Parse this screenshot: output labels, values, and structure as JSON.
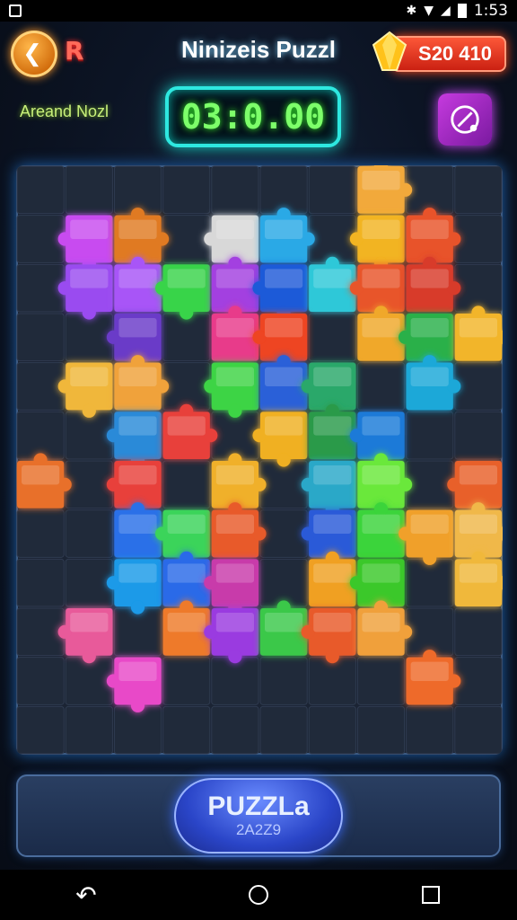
{
  "status_bar": {
    "time": "1:53"
  },
  "header": {
    "back_button_icon": "back-arrow-icon",
    "restart_label": "R",
    "title": "Ninizeis Puzzl",
    "score": "S20 410",
    "score_icon": "gem-icon"
  },
  "subheader": {
    "level_label": "Areand Nozl",
    "timer": "03:0.00",
    "hint_icon": "pencil-icon"
  },
  "board": {
    "columns": 10,
    "rows": 12,
    "pieces": [
      {
        "c": 7,
        "r": 0,
        "color": "#f2a93b"
      },
      {
        "c": 1,
        "r": 1,
        "color": "#c84cf0"
      },
      {
        "c": 2,
        "r": 1,
        "color": "#e07a22"
      },
      {
        "c": 4,
        "r": 1,
        "color": "#d8d8d8"
      },
      {
        "c": 5,
        "r": 1,
        "color": "#2aa9e6"
      },
      {
        "c": 7,
        "r": 1,
        "color": "#f2b420"
      },
      {
        "c": 8,
        "r": 1,
        "color": "#e8532a"
      },
      {
        "c": 1,
        "r": 2,
        "color": "#9a4cf0"
      },
      {
        "c": 2,
        "r": 2,
        "color": "#a855f7"
      },
      {
        "c": 3,
        "r": 2,
        "color": "#38d44a"
      },
      {
        "c": 4,
        "r": 2,
        "color": "#a340e0"
      },
      {
        "c": 5,
        "r": 2,
        "color": "#1f5ad8"
      },
      {
        "c": 6,
        "r": 2,
        "color": "#2ec8d8"
      },
      {
        "c": 7,
        "r": 2,
        "color": "#e8542a"
      },
      {
        "c": 8,
        "r": 2,
        "color": "#d83a2a"
      },
      {
        "c": 2,
        "r": 3,
        "color": "#6a3ac8"
      },
      {
        "c": 4,
        "r": 3,
        "color": "#e83a8a"
      },
      {
        "c": 5,
        "r": 3,
        "color": "#ee4420"
      },
      {
        "c": 7,
        "r": 3,
        "color": "#f0a82a"
      },
      {
        "c": 8,
        "r": 3,
        "color": "#2ab04a"
      },
      {
        "c": 9,
        "r": 3,
        "color": "#f2b52a"
      },
      {
        "c": 1,
        "r": 4,
        "color": "#f0b73a"
      },
      {
        "c": 2,
        "r": 4,
        "color": "#f0a23a"
      },
      {
        "c": 4,
        "r": 4,
        "color": "#3ed444"
      },
      {
        "c": 5,
        "r": 4,
        "color": "#2a60d8"
      },
      {
        "c": 6,
        "r": 4,
        "color": "#2aa86a"
      },
      {
        "c": 8,
        "r": 4,
        "color": "#1aa8d8"
      },
      {
        "c": 2,
        "r": 5,
        "color": "#2a8ad8"
      },
      {
        "c": 3,
        "r": 5,
        "color": "#e8403a"
      },
      {
        "c": 5,
        "r": 5,
        "color": "#f0b020"
      },
      {
        "c": 6,
        "r": 5,
        "color": "#2a9a4a"
      },
      {
        "c": 7,
        "r": 5,
        "color": "#1a7ad8"
      },
      {
        "c": 0,
        "r": 6,
        "color": "#e8702a"
      },
      {
        "c": 2,
        "r": 6,
        "color": "#e8403a"
      },
      {
        "c": 4,
        "r": 6,
        "color": "#f0b02a"
      },
      {
        "c": 6,
        "r": 6,
        "color": "#2aa8c8"
      },
      {
        "c": 7,
        "r": 6,
        "color": "#6ae83a"
      },
      {
        "c": 9,
        "r": 6,
        "color": "#e8602a"
      },
      {
        "c": 2,
        "r": 7,
        "color": "#2a70e8"
      },
      {
        "c": 3,
        "r": 7,
        "color": "#3ad45a"
      },
      {
        "c": 4,
        "r": 7,
        "color": "#e85a2a"
      },
      {
        "c": 6,
        "r": 7,
        "color": "#2a5ad8"
      },
      {
        "c": 7,
        "r": 7,
        "color": "#3ad43a"
      },
      {
        "c": 8,
        "r": 7,
        "color": "#f0a02a"
      },
      {
        "c": 9,
        "r": 7,
        "color": "#f0b84a"
      },
      {
        "c": 2,
        "r": 8,
        "color": "#1a9ae8"
      },
      {
        "c": 3,
        "r": 8,
        "color": "#2a6ae8"
      },
      {
        "c": 4,
        "r": 8,
        "color": "#c83aaa"
      },
      {
        "c": 6,
        "r": 8,
        "color": "#f0a020"
      },
      {
        "c": 7,
        "r": 8,
        "color": "#3ac82a"
      },
      {
        "c": 9,
        "r": 8,
        "color": "#f0b83a"
      },
      {
        "c": 1,
        "r": 9,
        "color": "#e85a9a"
      },
      {
        "c": 3,
        "r": 9,
        "color": "#ee7a2a"
      },
      {
        "c": 4,
        "r": 9,
        "color": "#9a3ae0"
      },
      {
        "c": 5,
        "r": 9,
        "color": "#3ac84a"
      },
      {
        "c": 6,
        "r": 9,
        "color": "#e85a2a"
      },
      {
        "c": 7,
        "r": 9,
        "color": "#f0a03a"
      },
      {
        "c": 2,
        "r": 10,
        "color": "#e84ac8"
      },
      {
        "c": 8,
        "r": 10,
        "color": "#ee6a2a"
      }
    ]
  },
  "play_button": {
    "label": "PUZZLa",
    "sublabel": "2A2Z9"
  },
  "nav_bar": {
    "back_icon": "nav-back-icon",
    "home_icon": "nav-home-icon",
    "recents_icon": "nav-recents-icon"
  }
}
